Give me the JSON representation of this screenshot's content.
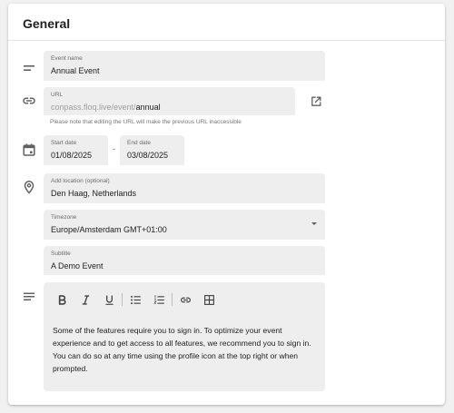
{
  "section": {
    "title": "General"
  },
  "event_name": {
    "label": "Event name",
    "value": "Annual Event"
  },
  "url": {
    "label": "URL",
    "prefix": "conpass.floq.live/event/",
    "value": "annual",
    "hint": "Please note that editing the URL will make the previous URL inaccessible"
  },
  "start_date": {
    "label": "Start date",
    "value": "01/08/2025"
  },
  "date_separator": "-",
  "end_date": {
    "label": "End date",
    "value": "03/08/2025"
  },
  "location": {
    "label": "Add location (optional)",
    "value": "Den Haag, Netherlands"
  },
  "timezone": {
    "label": "Timezone",
    "value": "Europe/Amsterdam GMT+01:00"
  },
  "subtitle": {
    "label": "Subtitle",
    "value": "A Demo Event"
  },
  "editor": {
    "toolbar_icons": [
      "bold-icon",
      "italic-icon",
      "underline-icon",
      "bulleted-list-icon",
      "numbered-list-icon",
      "link-icon",
      "table-icon"
    ],
    "content": "Some of the features require you to sign in. To optimize your event experience and to get access to all features, we recommend you to sign in. You can do so at any time using the profile icon at the top right or when prompted."
  }
}
